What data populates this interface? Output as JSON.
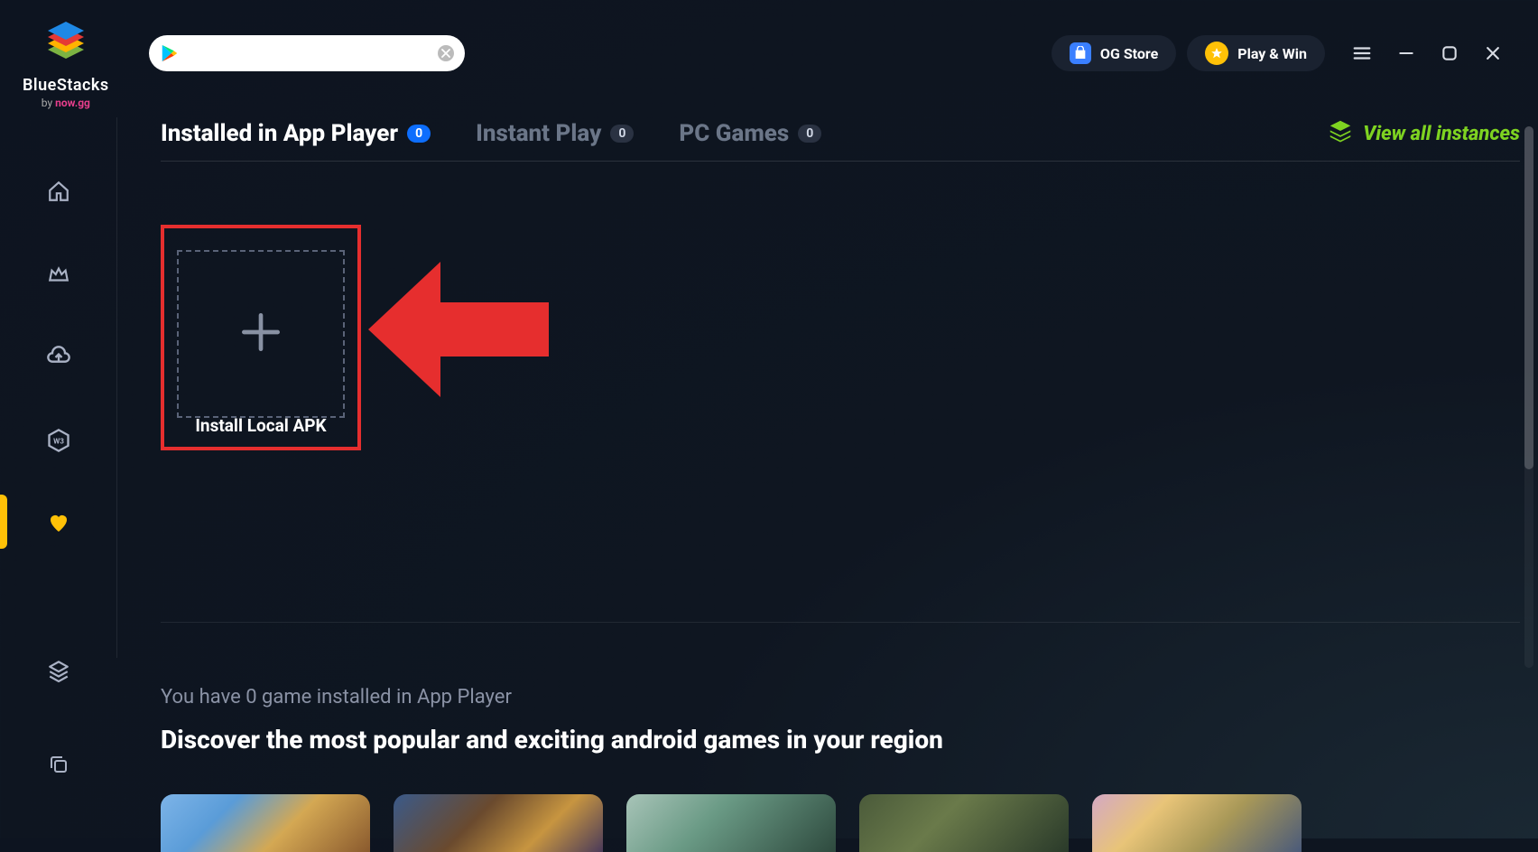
{
  "logo": {
    "name": "BlueStacks",
    "byline_prefix": "by",
    "byline_brand": "now.gg"
  },
  "header": {
    "search_placeholder": "",
    "og_store_label": "OG Store",
    "play_win_label": "Play & Win"
  },
  "tabs": [
    {
      "label": "Installed in App Player",
      "badge": "0",
      "active": true,
      "blue": true
    },
    {
      "label": "Instant Play",
      "badge": "0",
      "active": false,
      "blue": false
    },
    {
      "label": "PC Games",
      "badge": "0",
      "active": false,
      "blue": false
    }
  ],
  "view_instances_label": "View all instances",
  "install_apk": {
    "label": "Install Local APK"
  },
  "bottom": {
    "installed_text": "You have 0 game installed in App Player",
    "discover_title": "Discover the most popular and exciting android games in your region"
  }
}
